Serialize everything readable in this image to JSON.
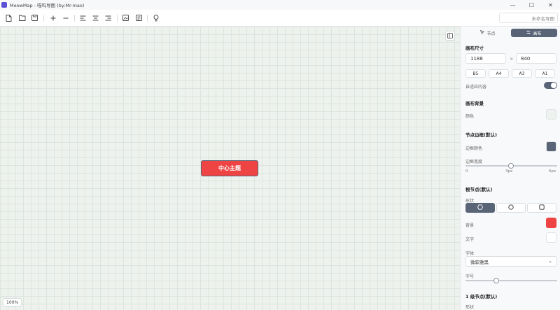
{
  "window": {
    "app_title": "MeowMap - 喵呜导图 (by:Mr-mao)",
    "controls": {
      "minimize": "—",
      "maximize": "☐",
      "close": "✕"
    }
  },
  "toolbar": {
    "buttons": [
      "new-file",
      "open-file",
      "save",
      "add-node",
      "remove-node",
      "align-left",
      "align-center",
      "align-right",
      "export-image",
      "export-file",
      "tips"
    ],
    "title_placeholder": "未命名导图"
  },
  "canvas": {
    "center_node": {
      "label": "中心主题",
      "fill": "#ef4444",
      "border": "#5a6477"
    },
    "zoom": "100%",
    "grid_color": "#dde4dd"
  },
  "panel": {
    "tabs": [
      {
        "label": "节点",
        "icon": "cursor-icon",
        "active": false
      },
      {
        "label": "画布",
        "icon": "layout-icon",
        "active": true
      }
    ],
    "canvas_size": {
      "title": "画布尺寸",
      "width": "1188",
      "height": "840",
      "separator": "×",
      "paper_sizes": [
        "B5",
        "A4",
        "A3",
        "A1"
      ],
      "adaptive_label": "自适应内容",
      "adaptive_on": true
    },
    "background": {
      "title": "画布背景",
      "color_label": "颜色",
      "color": "#eef2ee"
    },
    "node_border": {
      "title": "节点边框(默认)",
      "color_label": "边框颜色",
      "color": "#5a6477",
      "width_label": "边框宽度",
      "width_value": 3,
      "width_min": "0",
      "width_mid": "3px",
      "width_max": "6px"
    },
    "root_node": {
      "title": "根节点(默认)",
      "shape_label": "形状",
      "shapes": [
        "hexagon",
        "circle",
        "rounded-square"
      ],
      "active_shape": "hexagon",
      "bg_label": "背景",
      "bg_color": "#ef4444",
      "text_label": "文字",
      "text_color": "#ffffff",
      "font_label": "字体",
      "font_value": "微软雅黑",
      "font_size_label": "字号",
      "font_size_level": 0.33
    },
    "level1": {
      "title": "1 级节点(默认)",
      "shape_label": "形状"
    }
  }
}
